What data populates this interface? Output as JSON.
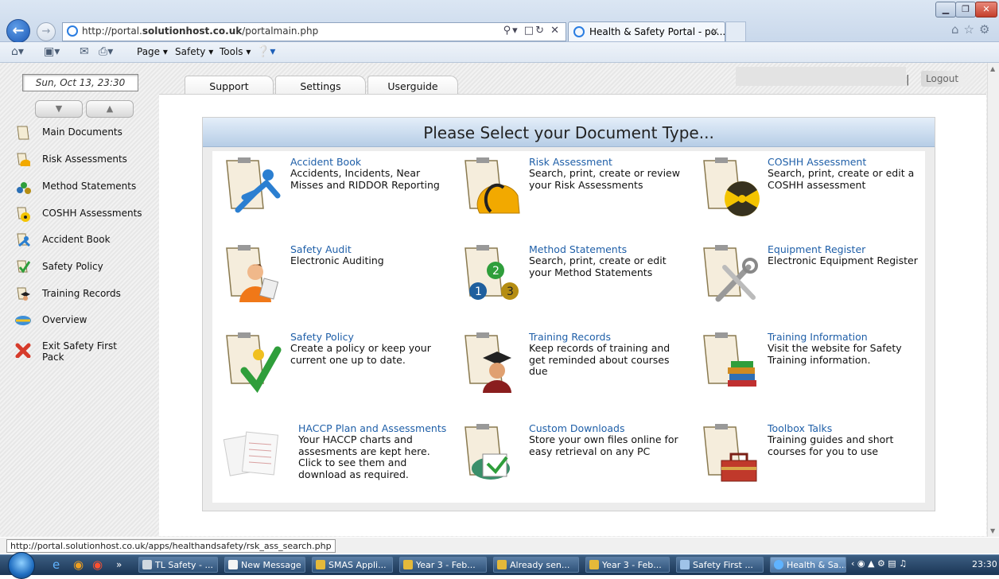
{
  "browser": {
    "url_prefix": "http://portal.",
    "url_domain": "solutionhost.co.uk",
    "url_path": "/portalmain.php",
    "tab_title": "Health & Safety Portal - po...",
    "tab_close": "×",
    "commands": {
      "page": "Page ▾",
      "safety": "Safety ▾",
      "tools": "Tools ▾"
    },
    "window": {
      "minimize": "▁",
      "maximize": "❐",
      "close": "✕"
    }
  },
  "sidebar": {
    "date": "Sun, Oct 13, 23:30",
    "arrow_down": "▼",
    "arrow_up": "▲",
    "items": [
      {
        "label": "Main Documents",
        "icon": "document-icon"
      },
      {
        "label": "Risk Assessments",
        "icon": "hardhat-icon"
      },
      {
        "label": "Method Statements",
        "icon": "method-icon"
      },
      {
        "label": "COSHH Assessments",
        "icon": "hazard-icon"
      },
      {
        "label": "Accident Book",
        "icon": "accident-icon"
      },
      {
        "label": "Safety Policy",
        "icon": "checkmark-icon"
      },
      {
        "label": "Training Records",
        "icon": "graduate-icon"
      },
      {
        "label": "Overview",
        "icon": "overview-icon"
      },
      {
        "label": "Exit Safety First Pack",
        "icon": "exit-x-icon"
      }
    ]
  },
  "top_tabs": [
    "Support",
    "Settings",
    "Userguide"
  ],
  "logout": {
    "separator": "|",
    "label": "Logout"
  },
  "panel": {
    "header": "Please Select your Document Type...",
    "documents": [
      {
        "title": "Accident Book",
        "desc": "Accidents, Incidents, Near Misses and RIDDOR Reporting",
        "icon": "accident-figure-icon"
      },
      {
        "title": "Risk Assessment",
        "desc": "Search, print, create or review your Risk Assessments",
        "icon": "hardhat-clipboard-icon"
      },
      {
        "title": "COSHH Assessment",
        "desc": "Search, print, create or edit a COSHH assessment",
        "icon": "radiation-clipboard-icon"
      },
      {
        "title": "Safety Audit",
        "desc": "Electronic Auditing",
        "icon": "auditor-clipboard-icon"
      },
      {
        "title": "Method Statements",
        "desc": "Search, print, create or edit your Method Statements",
        "icon": "numbered-balls-icon"
      },
      {
        "title": "Equipment Register",
        "desc": "Electronic Equipment Register",
        "icon": "tools-clipboard-icon"
      },
      {
        "title": "Safety Policy",
        "desc": "Create a policy or keep your current one up to date.",
        "icon": "checkmark-clipboard-icon"
      },
      {
        "title": "Training Records",
        "desc": "Keep records of training and get reminded about courses due",
        "icon": "graduate-clipboard-icon"
      },
      {
        "title": "Training Information",
        "desc": "Visit the website for Safety Training information.",
        "icon": "books-clipboard-icon"
      },
      {
        "title": "HACCP Plan and Assessments",
        "desc": "Your HACCP charts and assesments are kept here. Click to see them and download as required.",
        "icon": "haccp-documents-icon"
      },
      {
        "title": "Custom Downloads",
        "desc": "Store your own files online for easy retrieval on any PC",
        "icon": "download-clipboard-icon"
      },
      {
        "title": "Toolbox Talks",
        "desc": "Training guides and short courses for you to use",
        "icon": "toolbox-clipboard-icon"
      }
    ]
  },
  "status_url": "http://portal.solutionhost.co.uk/apps/healthandsafety/rsk_ass_search.php",
  "taskbar": {
    "overflow": "»",
    "buttons": [
      "TL Safety - ...",
      "New Message",
      "SMAS Appli...",
      "Year 3 - Feb...",
      "Already sen...",
      "Year 3 - Feb...",
      "Safety First ...",
      "Health & Sa..."
    ],
    "tray_chevron": "‹",
    "clock": "23:30"
  }
}
